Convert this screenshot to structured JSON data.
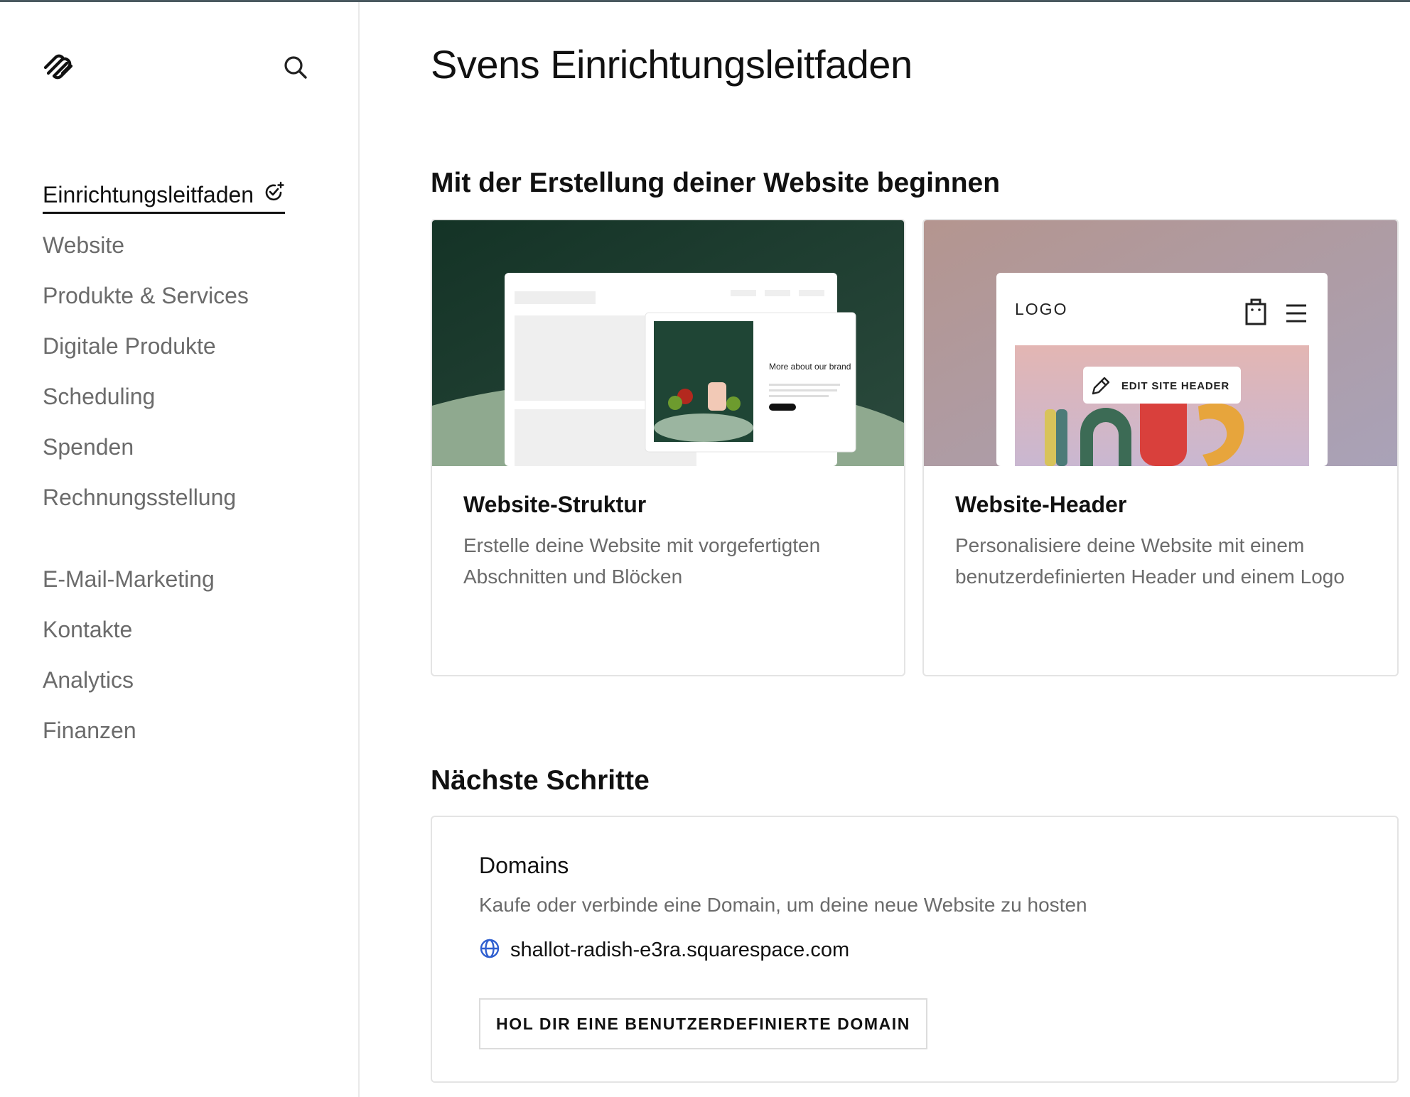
{
  "page_title": "Svens Einrichtungsleitfaden",
  "sidebar": {
    "items": [
      {
        "label": "Einrichtungsleitfaden",
        "active": true
      },
      {
        "label": "Website"
      },
      {
        "label": "Produkte & Services"
      },
      {
        "label": "Digitale Produkte"
      },
      {
        "label": "Scheduling"
      },
      {
        "label": "Spenden"
      },
      {
        "label": "Rechnungsstellung"
      },
      {
        "label": "E-Mail-Marketing"
      },
      {
        "label": "Kontakte"
      },
      {
        "label": "Analytics"
      },
      {
        "label": "Finanzen"
      }
    ]
  },
  "section_start": {
    "title": "Mit der Erstellung deiner Website beginnen",
    "cards": [
      {
        "title": "Website-Struktur",
        "description": "Erstelle deine Website mit vorgefertigten Abschnitten und Blöcken",
        "preview_text": "More about our brand"
      },
      {
        "title": "Website-Header",
        "description": "Personalisiere deine Website mit einem benutzerdefinierten Header und einem Logo",
        "preview_logo": "LOGO",
        "preview_button": "EDIT SITE HEADER"
      }
    ]
  },
  "section_next": {
    "title": "Nächste Schritte",
    "domains": {
      "title": "Domains",
      "description": "Kaufe oder verbinde eine Domain, um deine neue Website zu hosten",
      "domain": "shallot-radish-e3ra.squarespace.com",
      "button": "HOL DIR EINE BENUTZERDEFINIERTE DOMAIN"
    }
  },
  "colors": {
    "accent_globe": "#2f5fd0",
    "muted_text": "#6b6b6b",
    "card1_bg": "#1e3a2f",
    "card2_bg": "#b99a96"
  }
}
